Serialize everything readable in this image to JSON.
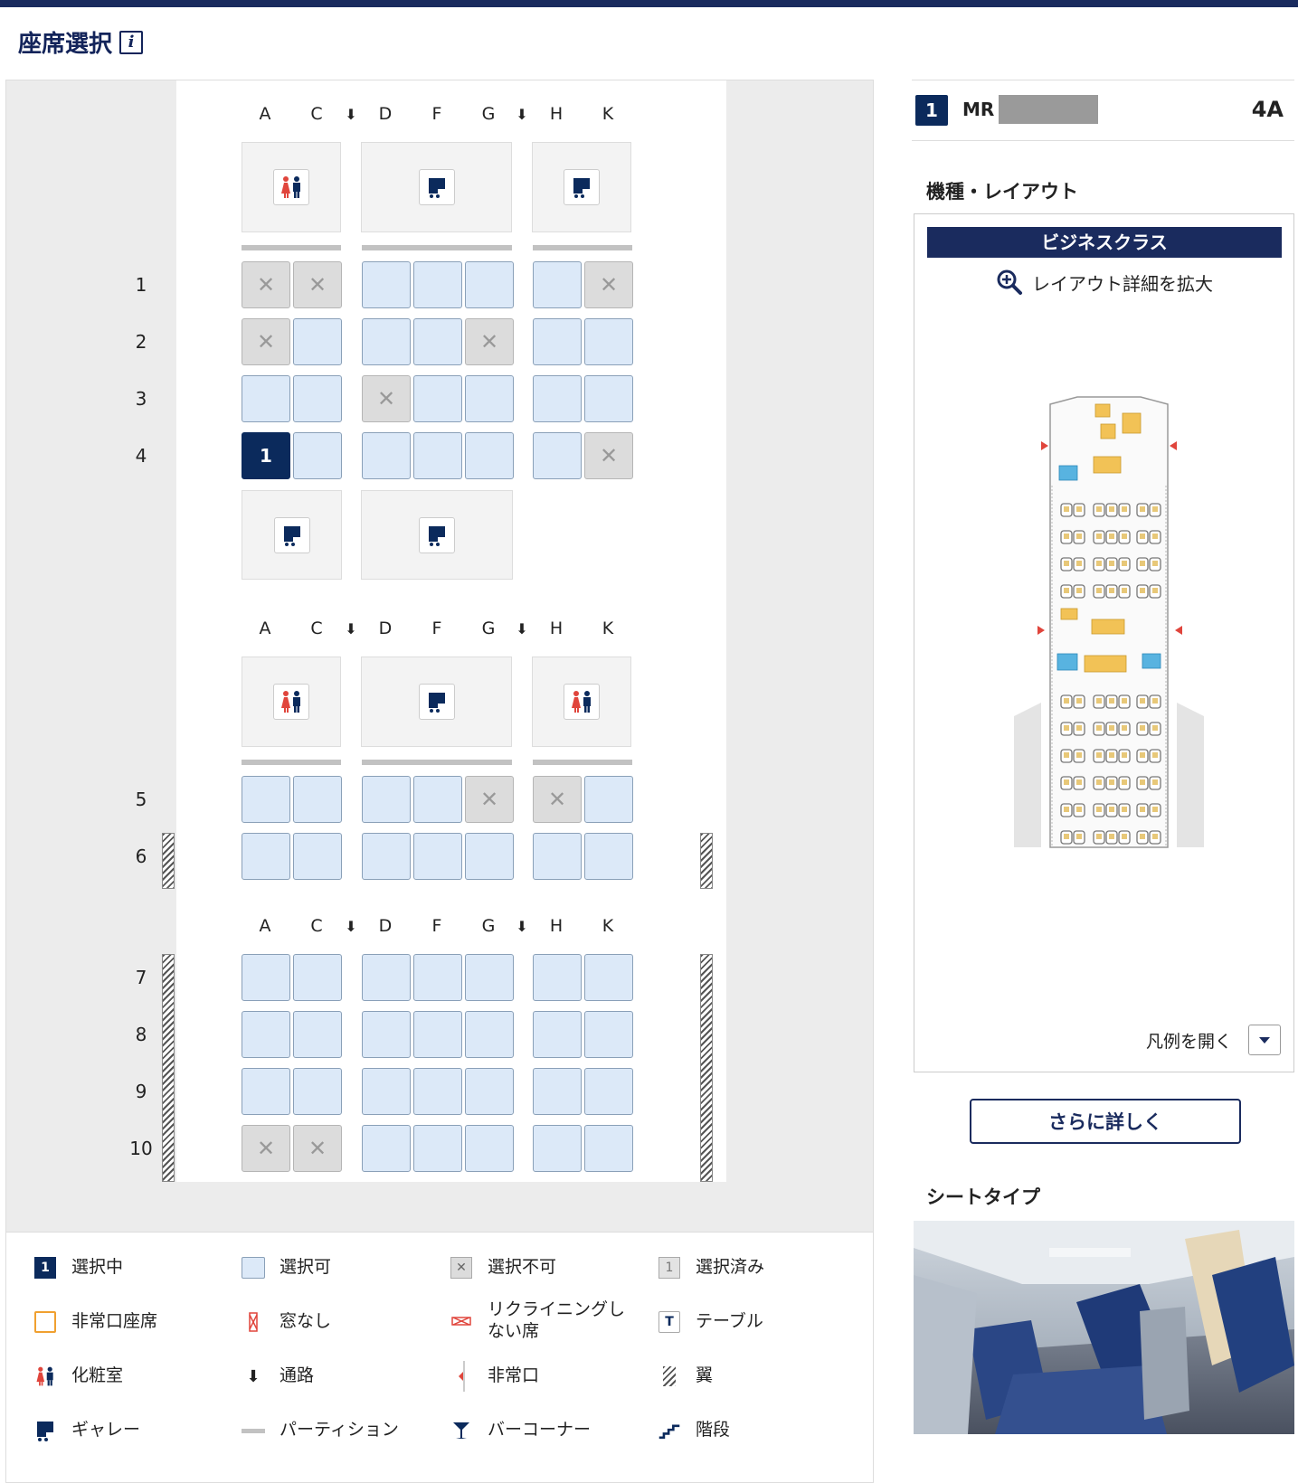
{
  "page": {
    "title": "座席選択"
  },
  "columns": [
    "A",
    "C",
    "D",
    "F",
    "G",
    "H",
    "K"
  ],
  "aisle_symbol": "⬇",
  "rows": [
    {
      "num": "1",
      "seats": [
        "x",
        "x",
        "o",
        "o",
        "o",
        "o",
        "x"
      ]
    },
    {
      "num": "2",
      "seats": [
        "x",
        "o",
        "o",
        "o",
        "x",
        "o",
        "o"
      ]
    },
    {
      "num": "3",
      "seats": [
        "o",
        "o",
        "x",
        "o",
        "o",
        "o",
        "o"
      ]
    },
    {
      "num": "4",
      "seats": [
        "s",
        "o",
        "o",
        "o",
        "o",
        "o",
        "x"
      ]
    },
    {
      "num": "5",
      "seats": [
        "o",
        "o",
        "o",
        "o",
        "x",
        "x",
        "o"
      ]
    },
    {
      "num": "6",
      "seats": [
        "o",
        "o",
        "o",
        "o",
        "o",
        "o",
        "o"
      ]
    },
    {
      "num": "7",
      "seats": [
        "o",
        "o",
        "o",
        "o",
        "o",
        "o",
        "o"
      ]
    },
    {
      "num": "8",
      "seats": [
        "o",
        "o",
        "o",
        "o",
        "o",
        "o",
        "o"
      ]
    },
    {
      "num": "9",
      "seats": [
        "o",
        "o",
        "o",
        "o",
        "o",
        "o",
        "o"
      ]
    },
    {
      "num": "10",
      "seats": [
        "x",
        "x",
        "o",
        "o",
        "o",
        "o",
        "o"
      ]
    }
  ],
  "selected_seat_label": "1",
  "unavailable_mark": "✕",
  "passenger": {
    "number": "1",
    "title": "MR",
    "seat": "4A"
  },
  "layout": {
    "heading": "機種・レイアウト",
    "class_name": "ビジネスクラス",
    "zoom_label": "レイアウト詳細を拡大",
    "legend_toggle": "凡例を開く"
  },
  "more_button": "さらに詳しく",
  "seat_type_heading": "シートタイプ",
  "legend": [
    {
      "id": "selected",
      "label": "選択中",
      "icon": "selected-seat-icon"
    },
    {
      "id": "available",
      "label": "選択可",
      "icon": "available-seat-icon"
    },
    {
      "id": "unavailable",
      "label": "選択不可",
      "icon": "unavailable-seat-icon"
    },
    {
      "id": "taken",
      "label": "選択済み",
      "icon": "taken-seat-icon"
    },
    {
      "id": "exit-row",
      "label": "非常口座席",
      "icon": "exit-row-seat-icon"
    },
    {
      "id": "no-window",
      "label": "窓なし",
      "icon": "no-window-icon"
    },
    {
      "id": "no-recline",
      "label": "リクライニングし\nない席",
      "icon": "no-recline-icon"
    },
    {
      "id": "table",
      "label": "テーブル",
      "icon": "table-icon"
    },
    {
      "id": "lavatory",
      "label": "化粧室",
      "icon": "lavatory-icon"
    },
    {
      "id": "aisle",
      "label": "通路",
      "icon": "aisle-arrow-icon"
    },
    {
      "id": "exit",
      "label": "非常口",
      "icon": "emergency-exit-icon"
    },
    {
      "id": "wing",
      "label": "翼",
      "icon": "wing-icon"
    },
    {
      "id": "galley",
      "label": "ギャレー",
      "icon": "galley-icon"
    },
    {
      "id": "partition",
      "label": "パーティション",
      "icon": "partition-icon"
    },
    {
      "id": "bar",
      "label": "バーコーナー",
      "icon": "bar-corner-icon"
    },
    {
      "id": "stairs",
      "label": "階段",
      "icon": "stairs-icon"
    }
  ],
  "legend_selected_number": "1",
  "legend_taken_number": "1",
  "legend_table_letter": "T",
  "colors": {
    "navy": "#0b2a5c",
    "available": "#dce9f8",
    "unavailable": "#dcdcdc",
    "exit_row": "#f0a030",
    "lavatory_red": "#e0453c"
  }
}
